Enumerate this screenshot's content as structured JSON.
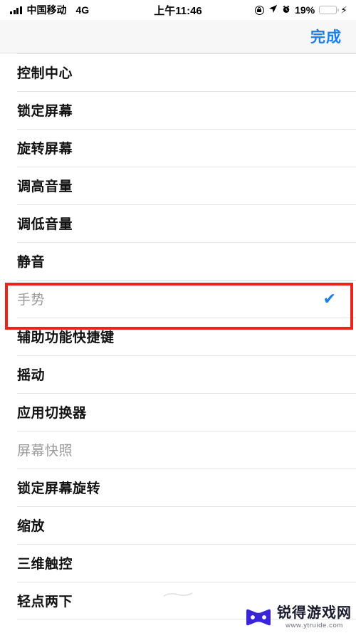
{
  "status_bar": {
    "carrier": "中国移动",
    "network_type": "4G",
    "time": "上午11:46",
    "battery_percent": "19%",
    "battery_level": 19,
    "signal_bars": 4,
    "icons": [
      "signal-bars-icon",
      "rotation-lock-icon",
      "location-arrow-icon",
      "alarm-clock-icon",
      "battery-icon",
      "charging-bolt-icon"
    ]
  },
  "nav_bar": {
    "done_label": "完成",
    "accent_color": "#1a7ded"
  },
  "list": {
    "checkmark_glyph": "✔",
    "items": [
      {
        "label": "控制中心",
        "state": "normal",
        "checked": false
      },
      {
        "label": "锁定屏幕",
        "state": "normal",
        "checked": false
      },
      {
        "label": "旋转屏幕",
        "state": "normal",
        "checked": false
      },
      {
        "label": "调高音量",
        "state": "normal",
        "checked": false
      },
      {
        "label": "调低音量",
        "state": "normal",
        "checked": false
      },
      {
        "label": "静音",
        "state": "normal",
        "checked": false
      },
      {
        "label": "手势",
        "state": "selected",
        "checked": true
      },
      {
        "label": "辅助功能快捷键",
        "state": "normal",
        "checked": false
      },
      {
        "label": "摇动",
        "state": "normal",
        "checked": false
      },
      {
        "label": "应用切换器",
        "state": "normal",
        "checked": false
      },
      {
        "label": "屏幕快照",
        "state": "disabled",
        "checked": false
      },
      {
        "label": "锁定屏幕旋转",
        "state": "normal",
        "checked": false
      },
      {
        "label": "缩放",
        "state": "normal",
        "checked": false
      },
      {
        "label": "三维触控",
        "state": "normal",
        "checked": false
      },
      {
        "label": "轻点两下",
        "state": "normal",
        "checked": false
      }
    ]
  },
  "annotation": {
    "target_label": "手势",
    "color": "#e8241c"
  },
  "watermark": {
    "site_name": "锐得游戏网",
    "url": "www.ytruide.com",
    "logo_color": "#3a24d8"
  }
}
